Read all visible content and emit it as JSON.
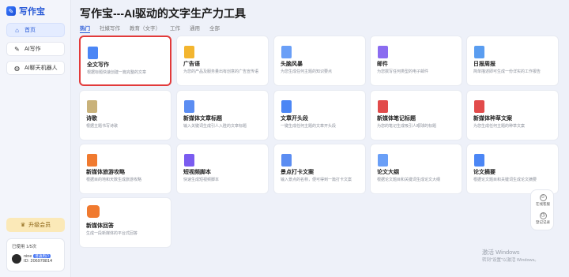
{
  "app": {
    "logo_text": "写作宝"
  },
  "sidebar": {
    "items": [
      {
        "label": "首页",
        "icon": "home-icon"
      },
      {
        "label": "AI写作",
        "icon": "pen-icon"
      },
      {
        "label": "AI聊天机器人",
        "icon": "chat-icon"
      }
    ],
    "upgrade_label": "升级会员",
    "usage_label": "已使用 1/5次",
    "user_name": "nine",
    "user_badge": "普通用户",
    "user_id": "ID: 206978814"
  },
  "main": {
    "title": "写作宝---AI驱动的文字生产力工具",
    "tabs": [
      "热门",
      "社媒写作",
      "教育（文字）",
      "工作",
      "通用",
      "全部"
    ],
    "active_tab": "热门"
  },
  "cards": [
    {
      "title": "全文写作",
      "desc": "根据标题快速创建一篇完整的文章",
      "color": "#4b86f5",
      "selected": true
    },
    {
      "title": "广告语",
      "desc": "为您的产品及服务量出有创意的广告宣传语",
      "color": "#f3b52f",
      "selected": false
    },
    {
      "title": "头脑风暴",
      "desc": "为您生成任何主题的知识要点",
      "color": "#6a9ff7",
      "selected": false
    },
    {
      "title": "邮件",
      "desc": "为您撰写任何类型的电子邮件",
      "color": "#8b6cf0",
      "selected": false
    },
    {
      "title": "日报周报",
      "desc": "简单描述即可生成一份详实的工作报告",
      "color": "#5a9df0",
      "selected": false
    },
    {
      "title": "诗歌",
      "desc": "根据主题书写诗歌",
      "color": "#c9b27a",
      "selected": false
    },
    {
      "title": "新媒体文章标题",
      "desc": "输入关键词生成引人入胜的文章标题",
      "color": "#5b8df2",
      "selected": false
    },
    {
      "title": "文章开头段",
      "desc": "一键生成任何主题的文章开头段",
      "color": "#4b86f5",
      "selected": false
    },
    {
      "title": "新媒体笔记标题",
      "desc": "为您的笔记生成吸引人眼球的标题",
      "color": "#e24b4b",
      "selected": false
    },
    {
      "title": "新媒体种草文案",
      "desc": "为您生成任何主题的种草文案",
      "color": "#e24b4b",
      "selected": false
    },
    {
      "title": "新媒体旅游攻略",
      "desc": "根据目的地和天数生成旅游攻略",
      "color": "#f07a2f",
      "selected": false
    },
    {
      "title": "短视频脚本",
      "desc": "快速生成短视频脚本",
      "color": "#7a5cf0",
      "selected": false
    },
    {
      "title": "景点打卡文案",
      "desc": "输入景点的名称，便可得到一篇打卡文案",
      "color": "#5b8df2",
      "selected": false
    },
    {
      "title": "论文大纲",
      "desc": "根据论文题目和关键词生成论文大纲",
      "color": "#6a9ff7",
      "selected": false
    },
    {
      "title": "论文摘要",
      "desc": "根据论文题目和关键词生成论文摘要",
      "color": "#4b86f5",
      "selected": false
    },
    {
      "title": "新媒体回答",
      "desc": "生成一段新媒体的平台式回答",
      "color": "#f07a2f",
      "selected": false
    }
  ],
  "right_panel": {
    "feedback_label": "在线客服",
    "record_label": "登记记录"
  },
  "watermark": {
    "line1": "激活 Windows",
    "line2": "转到\"设置\"以激活 Windows。"
  }
}
